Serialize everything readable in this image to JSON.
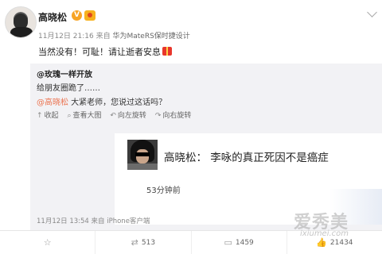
{
  "post": {
    "username": "高晓松",
    "badge_v": "V",
    "time": "11月12日 21:16",
    "via_prefix": "来自",
    "device": "华为MateRS保时捷设计",
    "text": "当然没有！可耻！请让逝者安息"
  },
  "repost": {
    "author": "@玫瑰一样开放",
    "text": "给朋友圈跪了……",
    "mention": "@高晓松",
    "mention_tail": " 大紧老师，您说过这话吗？",
    "actions": [
      "收起",
      "查看大图",
      "向左旋转",
      "向右旋转"
    ],
    "image": {
      "title": "高晓松：  李咏的真正死因不是癌症",
      "time": "53分钟前"
    },
    "meta": "11月12日 13:54 来自 iPhone客户端"
  },
  "footer": {
    "counts": [
      "513",
      "1459",
      "21434"
    ]
  },
  "watermark": {
    "text": "爱秀美",
    "url": "ixiumei.com"
  }
}
